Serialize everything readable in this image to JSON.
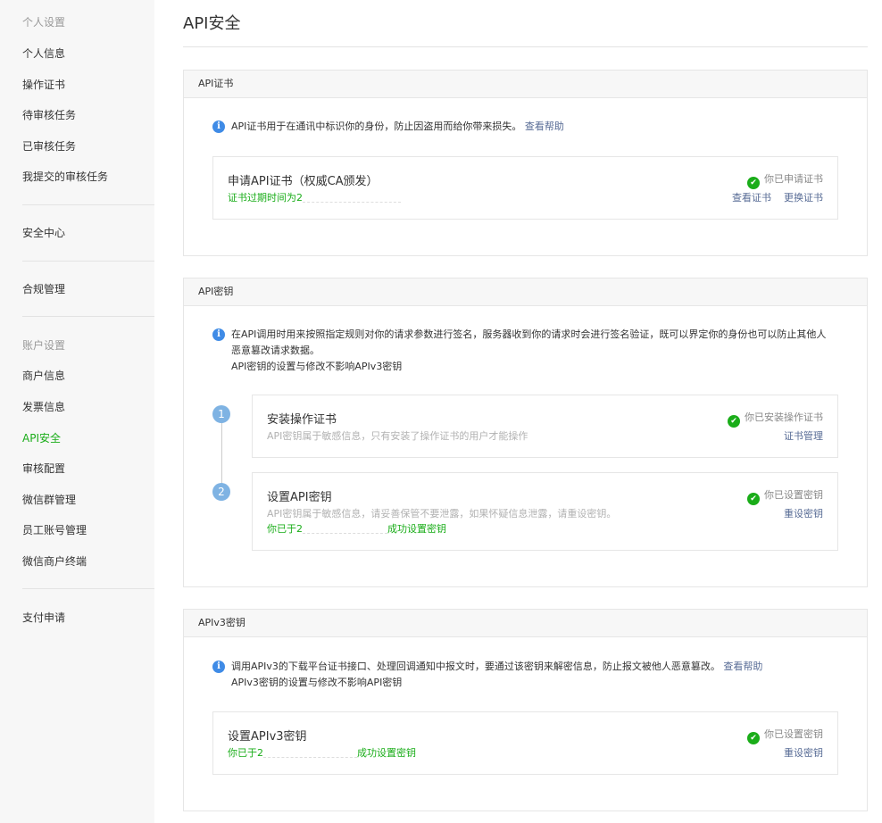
{
  "sidebar": {
    "section1_title": "个人设置",
    "section1_items": [
      "个人信息",
      "操作证书",
      "待审核任务",
      "已审核任务",
      "我提交的审核任务"
    ],
    "security_center": "安全中心",
    "compliance": "合规管理",
    "section2_title": "账户设置",
    "section2_items": [
      "商户信息",
      "发票信息",
      "API安全",
      "审核配置",
      "微信群管理",
      "员工账号管理",
      "微信商户终端"
    ],
    "payment_apply": "支付申请"
  },
  "page_title": "API安全",
  "cert_panel": {
    "title": "API证书",
    "info": "API证书用于在通讯中标识你的身份，防止因盗用而给你带来损失。",
    "help_link": "查看帮助",
    "card_title": "申请API证书（权威CA颁发）",
    "card_sub": "证书过期时间为2",
    "status": "你已申请证书",
    "link_view": "查看证书",
    "link_replace": "更换证书"
  },
  "key_panel": {
    "title": "API密钥",
    "info_line1": "在API调用时用来按照指定规则对你的请求参数进行签名，服务器收到你的请求时会进行签名验证，既可以界定你的身份也可以防止其他人",
    "info_line2": "恶意篡改请求数据。",
    "info_line3": "API密钥的设置与修改不影响APIv3密钥",
    "step1_num": "1",
    "step1_title": "安装操作证书",
    "step1_sub": "API密钥属于敏感信息，只有安装了操作证书的用户才能操作",
    "step1_status": "你已安装操作证书",
    "step1_link": "证书管理",
    "step2_num": "2",
    "step2_title": "设置API密钥",
    "step2_sub": "API密钥属于敏感信息，请妥善保管不要泄露，如果怀疑信息泄露，请重设密钥。",
    "step2_done_prefix": "你已于2",
    "step2_done_suffix": "成功设置密钥",
    "step2_status": "你已设置密钥",
    "step2_link": "重设密钥"
  },
  "v3_panel": {
    "title": "APIv3密钥",
    "info_line1": "调用APIv3的下载平台证书接口、处理回调通知中报文时，要通过该密钥来解密信息，防止报文被他人恶意篡改。",
    "help_link": "查看帮助",
    "info_line2": "APIv3密钥的设置与修改不影响API密钥",
    "card_title": "设置APIv3密钥",
    "done_prefix": "你已于2",
    "done_suffix": "成功设置密钥",
    "status": "你已设置密钥",
    "link": "重设密钥"
  },
  "colors": {
    "accent_green": "#1aad19",
    "link_blue": "#576b95",
    "info_blue": "#3f8be6"
  }
}
